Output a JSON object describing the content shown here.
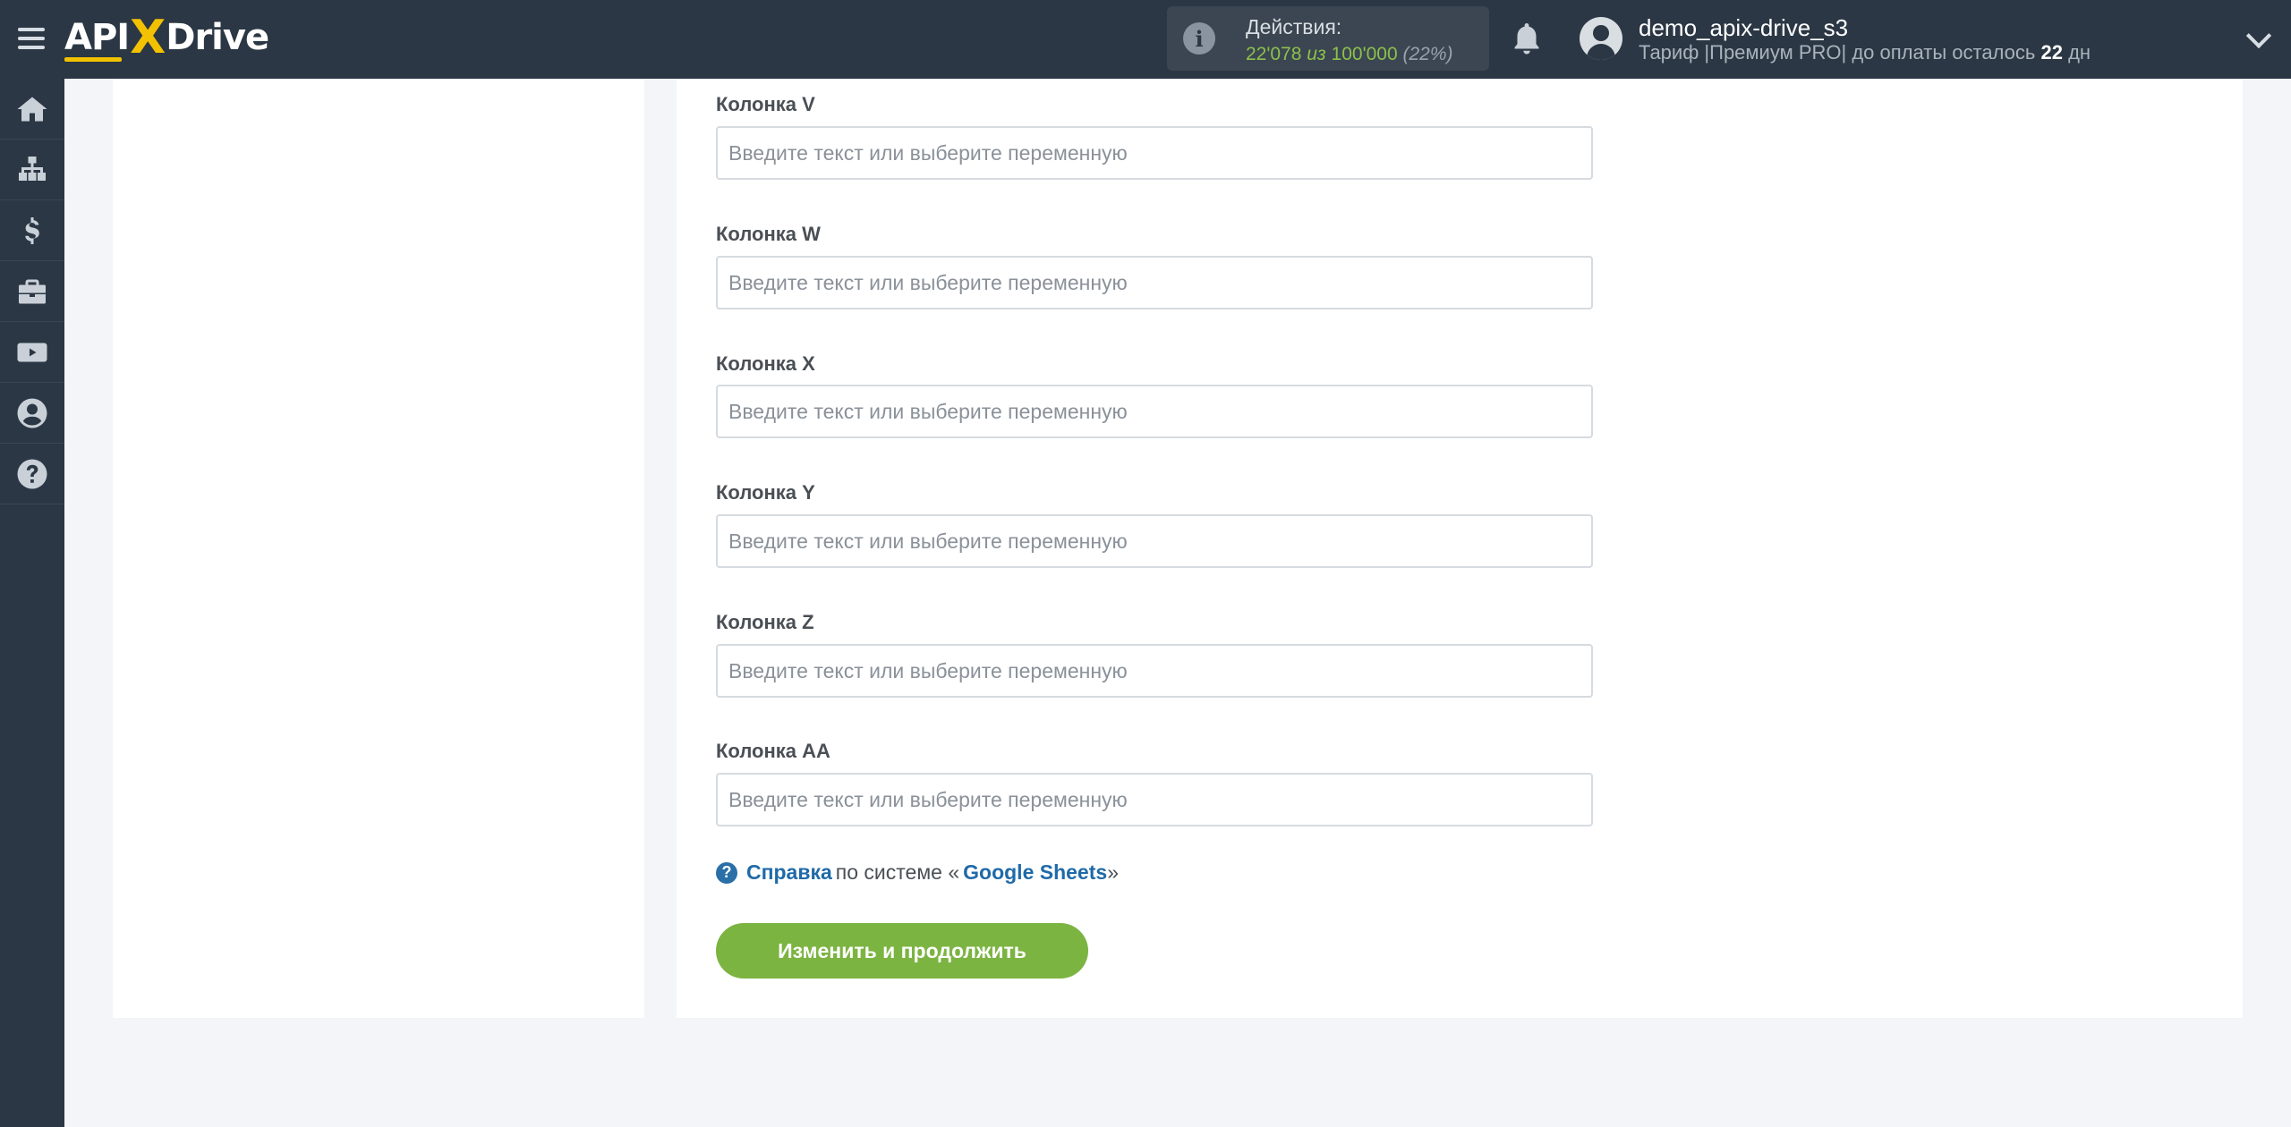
{
  "header": {
    "logo": {
      "part1": "API",
      "part2": "X",
      "part3": "Drive"
    },
    "actions": {
      "label": "Действия:",
      "used": "22'078",
      "of_word": "из",
      "total": "100'000",
      "percent": "(22%)"
    },
    "user": {
      "name": "demo_apix-drive_s3",
      "plan_prefix": "Тариф |Премиум PRO| до оплаты осталось",
      "days": "22",
      "days_unit": "дн"
    }
  },
  "sidebar": {
    "items": [
      {
        "icon": "home-icon"
      },
      {
        "icon": "sitemap-icon"
      },
      {
        "icon": "dollar-icon"
      },
      {
        "icon": "briefcase-icon"
      },
      {
        "icon": "youtube-icon"
      },
      {
        "icon": "user-circle-icon"
      },
      {
        "icon": "question-icon"
      }
    ]
  },
  "form": {
    "placeholder": "Введите текст или выберите переменную",
    "fields": [
      {
        "label": "Колонка V",
        "value": ""
      },
      {
        "label": "Колонка W",
        "value": ""
      },
      {
        "label": "Колонка X",
        "value": ""
      },
      {
        "label": "Колонка Y",
        "value": ""
      },
      {
        "label": "Колонка Z",
        "value": ""
      },
      {
        "label": "Колонка AA",
        "value": ""
      }
    ],
    "help": {
      "link1": "Справка",
      "middle": "по системе «",
      "link2": "Google Sheets",
      "end": "»"
    },
    "submit_label": "Изменить и продолжить"
  },
  "colors": {
    "header_bg": "#2b3744",
    "accent_green": "#7cb442",
    "logo_yellow": "#f2c200",
    "link_blue": "#1f6aa8"
  }
}
